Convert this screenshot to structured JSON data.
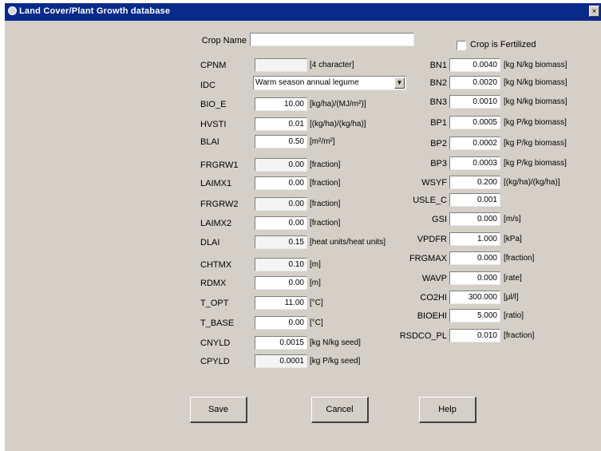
{
  "window": {
    "title": "Land Cover/Plant Growth database",
    "close_label": "×"
  },
  "crop_name": {
    "label": "Crop Name",
    "value": ""
  },
  "fertilized": {
    "label": "Crop is Fertilized",
    "checked": false
  },
  "left_fields": [
    {
      "key": "cpnm",
      "label": "CPNM",
      "value": "",
      "unit": "[4 character]"
    },
    {
      "key": "bio_e",
      "label": "BIO_E",
      "value": "10.00",
      "unit": "[kg/ha)/(MJ/m²)]"
    },
    {
      "key": "hvsti",
      "label": "HVSTI",
      "value": "0.01",
      "unit": "[(kg/ha)/(kg/ha)]"
    },
    {
      "key": "blai",
      "label": "BLAI",
      "value": "0.50",
      "unit": "[m²/m²]"
    },
    {
      "key": "frgrw1",
      "label": "FRGRW1",
      "value": "0.00",
      "unit": "[fraction]"
    },
    {
      "key": "laimx1",
      "label": "LAIMX1",
      "value": "0.00",
      "unit": "[fraction]"
    },
    {
      "key": "frgrw2",
      "label": "FRGRW2",
      "value": "0.00",
      "unit": "[fraction]"
    },
    {
      "key": "laimx2",
      "label": "LAIMX2",
      "value": "0.00",
      "unit": "[fraction]"
    },
    {
      "key": "dlai",
      "label": "DLAI",
      "value": "0.15",
      "unit": "[heat units/heat units]"
    },
    {
      "key": "chtmx",
      "label": "CHTMX",
      "value": "0.10",
      "unit": "[m]"
    },
    {
      "key": "rdmx",
      "label": "RDMX",
      "value": "0.00",
      "unit": "[m]"
    },
    {
      "key": "t_opt",
      "label": "T_OPT",
      "value": "11.00",
      "unit": "[°C]"
    },
    {
      "key": "t_base",
      "label": "T_BASE",
      "value": "0.00",
      "unit": "[°C]"
    },
    {
      "key": "cnyld",
      "label": "CNYLD",
      "value": "0.0015",
      "unit": "[kg N/kg seed]"
    },
    {
      "key": "cpyld",
      "label": "CPYLD",
      "value": "0.0001",
      "unit": "[kg P/kg seed]"
    }
  ],
  "idc": {
    "label": "IDC",
    "value": "Warm season annual legume"
  },
  "right_fields": [
    {
      "key": "bn1",
      "label": "BN1",
      "value": "0.0040",
      "unit": "[kg N/kg biomass]"
    },
    {
      "key": "bn2",
      "label": "BN2",
      "value": "0.0020",
      "unit": "[kg N/kg biomass]"
    },
    {
      "key": "bn3",
      "label": "BN3",
      "value": "0.0010",
      "unit": "[kg N/kg biomass]"
    },
    {
      "key": "bp1",
      "label": "BP1",
      "value": "0.0005",
      "unit": "[kg P/kg biomass]"
    },
    {
      "key": "bp2",
      "label": "BP2",
      "value": "0.0002",
      "unit": "[kg P/kg biomass]"
    },
    {
      "key": "bp3",
      "label": "BP3",
      "value": "0.0003",
      "unit": "[kg P/kg biomass]"
    },
    {
      "key": "wsyf",
      "label": "WSYF",
      "value": "0.200",
      "unit": "[(kg/ha)/(kg/ha)]"
    },
    {
      "key": "usle_c",
      "label": "USLE_C",
      "value": "0.001",
      "unit": ""
    },
    {
      "key": "gsi",
      "label": "GSI",
      "value": "0.000",
      "unit": "[m/s]"
    },
    {
      "key": "vpdfr",
      "label": "VPDFR",
      "value": "1.000",
      "unit": "[kPa]"
    },
    {
      "key": "frgmax",
      "label": "FRGMAX",
      "value": "0.000",
      "unit": "[fraction]"
    },
    {
      "key": "wavp",
      "label": "WAVP",
      "value": "0.000",
      "unit": "[rate]"
    },
    {
      "key": "co2hi",
      "label": "CO2HI",
      "value": "300.000",
      "unit": "[μl/l]"
    },
    {
      "key": "biaehi",
      "label": "BIOEHI",
      "value": "5.000",
      "unit": "[ratio]"
    },
    {
      "key": "rsdco_pl",
      "label": "RSDCO_PL",
      "value": "0.010",
      "unit": "[fraction]"
    }
  ],
  "buttons": {
    "save": "Save",
    "cancel": "Cancel",
    "help": "Help"
  },
  "colors": {
    "titlebar": "#0a2a8a",
    "dialog": "#d4d0c8"
  }
}
